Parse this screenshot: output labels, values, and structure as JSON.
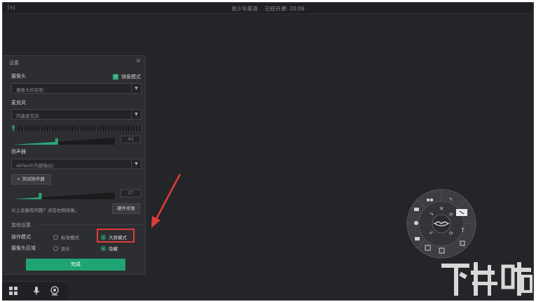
{
  "titlebar": {
    "menu_label": "[≡]",
    "title": "青少年英语",
    "status": "已经开课: 20:06"
  },
  "settings": {
    "title": "设置",
    "camera": {
      "label": "摄像头",
      "mirror_label": "镜像模式",
      "mirror_checked": true,
      "select_value": "摄像头的名称"
    },
    "microphone": {
      "label": "麦克风",
      "select_value": "内建麦克风",
      "volume": 43
    },
    "speaker": {
      "label": "扬声器",
      "select_value": "default(内建输出)",
      "test_button": "测试扬声器",
      "volume": 27
    },
    "hint": "以上设备有问题？点击右侧修复。",
    "repair_button": "硬件修复",
    "other": {
      "section_label": "其他设置",
      "mode_label": "操作模式",
      "mode_options": [
        "标准模式",
        "大屏模式"
      ],
      "mode_selected": "大屏模式",
      "camera_area_label": "摄像头区域",
      "camera_area_options": [
        "显示",
        "隐藏"
      ],
      "camera_area_selected": "隐藏"
    },
    "done_button": "完成"
  },
  "watermark": {
    "text": "下载吧"
  },
  "colors": {
    "accent": "#1fa574",
    "highlight": "#e23b3b",
    "window_bg": "#242528",
    "panel_bg": "#2d2e31"
  },
  "icons": [
    "grid-icon",
    "microphone-icon",
    "webcam-icon",
    "close-icon",
    "speaker-icon",
    "chevron-down-icon",
    "checkbox-icon"
  ]
}
